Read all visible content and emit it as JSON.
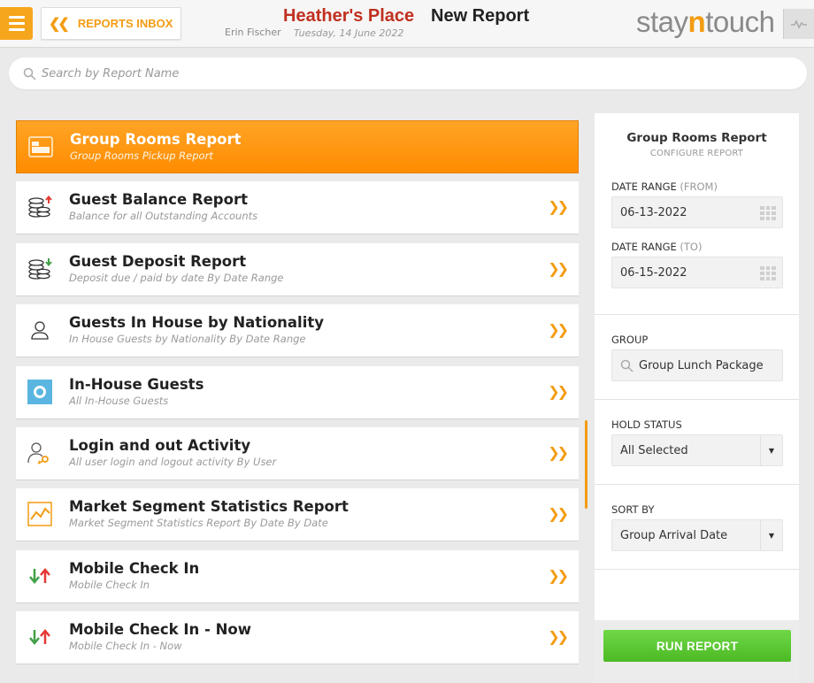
{
  "header": {
    "back_label": "REPORTS INBOX",
    "hotel_name": "Heather's Place",
    "page_title": "New Report",
    "user_name": "Erin Fischer",
    "date": "Tuesday, 14 June 2022",
    "logo_left": "stay",
    "logo_mid": "n",
    "logo_right": "touch"
  },
  "search": {
    "placeholder": "Search by Report Name"
  },
  "reports": [
    {
      "title": "Group Rooms Report",
      "subtitle": "Group Rooms Pickup Report",
      "icon": "bed-icon",
      "active": true
    },
    {
      "title": "Guest Balance Report",
      "subtitle": "Balance for all Outstanding Accounts",
      "icon": "coins-up-icon"
    },
    {
      "title": "Guest Deposit Report",
      "subtitle": "Deposit due / paid by date By Date Range",
      "icon": "coins-down-icon"
    },
    {
      "title": "Guests In House by Nationality",
      "subtitle": "In House Guests by Nationality By Date Range",
      "icon": "person-icon"
    },
    {
      "title": "In-House Guests",
      "subtitle": "All In-House Guests",
      "icon": "in-house-icon"
    },
    {
      "title": "Login and out Activity",
      "subtitle": "All user login and logout activity By User",
      "icon": "user-key-icon"
    },
    {
      "title": "Market Segment Statistics Report",
      "subtitle": "Market Segment Statistics Report By Date By Date",
      "icon": "chart-icon"
    },
    {
      "title": "Mobile Check In",
      "subtitle": "Mobile Check In",
      "icon": "arrows-icon"
    },
    {
      "title": "Mobile Check In - Now",
      "subtitle": "Mobile Check In - Now",
      "icon": "arrows-icon"
    }
  ],
  "panel": {
    "title": "Group Rooms Report",
    "subtitle": "CONFIGURE REPORT",
    "date_from_label": "DATE RANGE",
    "date_from_suffix": "(FROM)",
    "date_from_value": "06-13-2022",
    "date_to_label": "DATE RANGE",
    "date_to_suffix": "(TO)",
    "date_to_value": "06-15-2022",
    "group_label": "GROUP",
    "group_value": "Group Lunch Package",
    "hold_label": "HOLD STATUS",
    "hold_value": "All Selected",
    "sort_label": "SORT BY",
    "sort_value": "Group Arrival Date",
    "run_label": "RUN REPORT"
  },
  "colors": {
    "accent": "#f39c12",
    "hotel_name": "#c0301f",
    "run_button": "#4cba24"
  }
}
